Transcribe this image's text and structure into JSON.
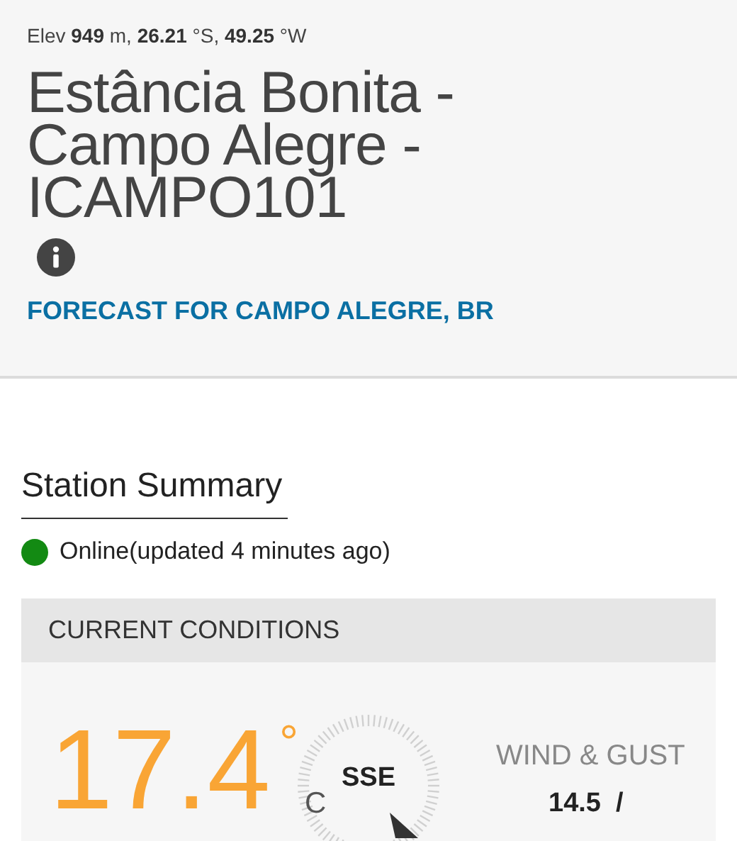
{
  "header": {
    "location_line": "Elev **949** m, **26.21** °S, **49.25** °W",
    "station_name": "Estância Bonita - Campo Alegre - ICAMPO101",
    "forecast_link": "FORECAST FOR CAMPO ALEGRE, BR"
  },
  "summary": {
    "title": "Station Summary",
    "status": {
      "online": true,
      "text": "Online(updated 4 minutes ago)"
    }
  },
  "current_conditions": {
    "title": "CURRENT CONDITIONS",
    "temperature": "17.4",
    "degree": "°",
    "unit": "C",
    "wind_direction": "SSE",
    "wind_label": "WIND & GUST",
    "wind_speed": "14.5  /"
  }
}
